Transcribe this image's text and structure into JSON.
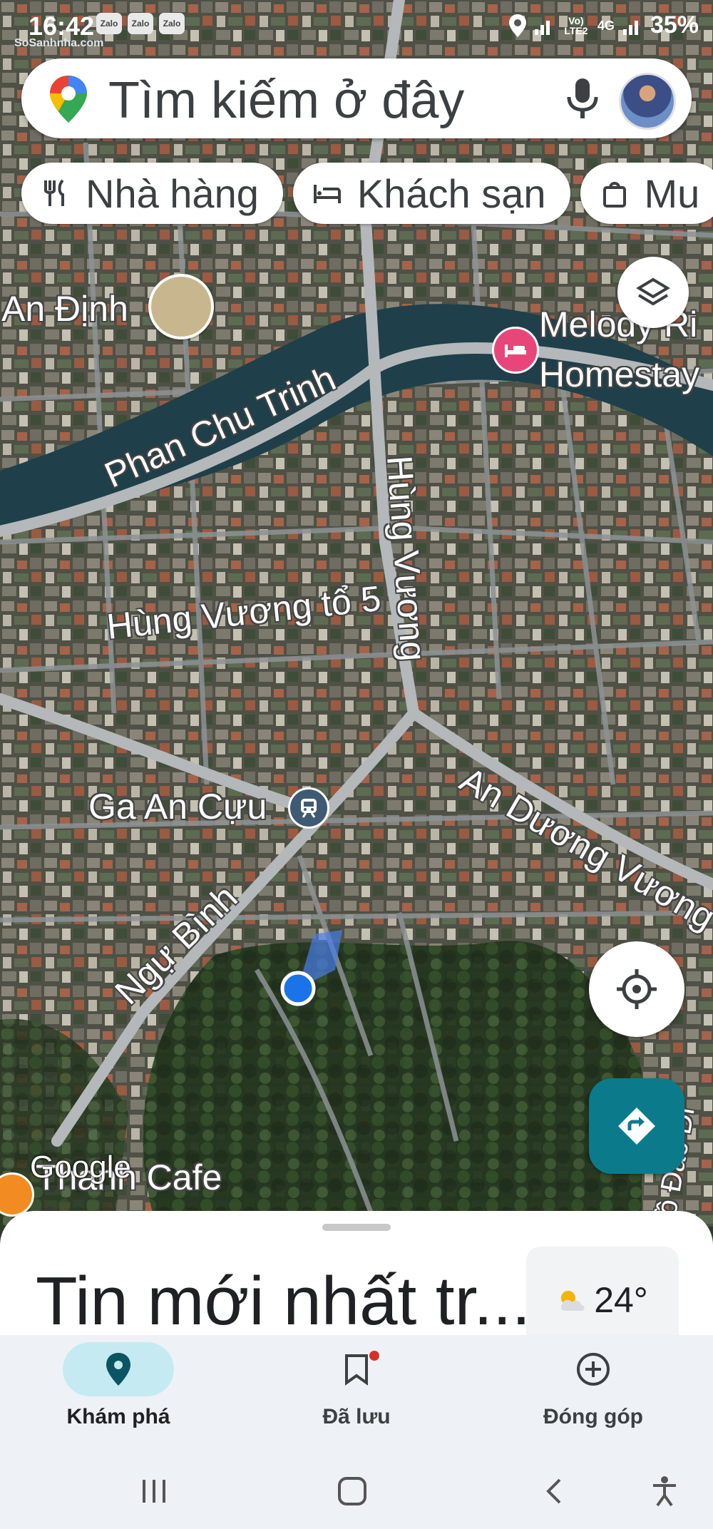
{
  "status_bar": {
    "time": "16:42",
    "apps": [
      "Zalo",
      "Zalo",
      "Zalo"
    ],
    "watermark": "SoSanhnha.com",
    "network": "Vo) LTE2",
    "network_type": "4G",
    "battery": "35%"
  },
  "search": {
    "placeholder": "Tìm kiếm ở đây",
    "icons": [
      "maps-pin-icon",
      "mic-icon",
      "avatar"
    ]
  },
  "chips": [
    {
      "label": "Nhà hàng",
      "icon": "fork-knife-icon"
    },
    {
      "label": "Khách sạn",
      "icon": "bed-icon"
    },
    {
      "label": "Mu",
      "icon": "shopping-bag-icon"
    }
  ],
  "map": {
    "labels": {
      "an_dinh": "An Định",
      "melody_1": "Melody Ri",
      "melody_2": "Homestay",
      "phan_chu_trinh": "Phan Chu Trinh",
      "hung_vuong": "Hùng Vương",
      "hung_vuong_to5": "Hùng Vương tổ 5",
      "ga_an_cuu": "Ga An Cựu",
      "an_duong_vuong": "An Dương Vương",
      "ngu_binh": "Ngự Bình",
      "ho_dac_di": "Hồ Đắc Di",
      "thanh_cafe": "Thanh Cafe",
      "google": "Google"
    },
    "colors": {
      "water": "#1f3f4a",
      "road": "#9aa0a2",
      "location": "#1a73e8",
      "hotel_pin": "#e8467a",
      "cafe_pin": "#f28b22"
    }
  },
  "sheet": {
    "title": "Tin mới nhất tr...",
    "weather_temp": "24°",
    "weather_icon": "partly-cloudy-icon"
  },
  "bottom_nav": [
    {
      "label": "Khám phá",
      "icon": "explore-pin-icon",
      "active": true
    },
    {
      "label": "Đã lưu",
      "icon": "bookmark-icon",
      "active": false
    },
    {
      "label": "Đóng góp",
      "icon": "add-circle-icon",
      "active": false
    }
  ],
  "system_nav": [
    "recents-icon",
    "home-icon",
    "back-icon",
    "accessibility-icon"
  ],
  "accent_color": "#0b7b8c"
}
